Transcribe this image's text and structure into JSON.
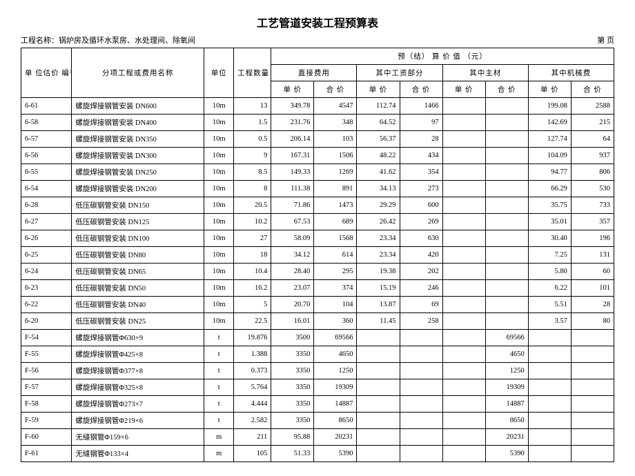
{
  "title": "工艺管道安装工程预算表",
  "project_label": "工程名称：锅炉房及循环水泵房、水处理间、除氧间",
  "page_label": "第  页",
  "headers": {
    "code": "单  位估价\n编号",
    "name": "分项工程或费用名称",
    "unit": "单位",
    "qty": "工程数量",
    "budget_group": "预（结） 算 价 值 （元）",
    "direct": "直接费用",
    "labor": "其中工资部分",
    "material": "其中主材",
    "machine": "其中机械费",
    "unit_price": "单  价",
    "total_price": "合  价"
  },
  "rows": [
    {
      "code": "6-61",
      "name": "螺旋焊接钢管安装 DN600",
      "unit": "10m",
      "qty": "13",
      "du": "349.78",
      "dt": "4547",
      "lu": "112.74",
      "lt": "1466",
      "mu": "",
      "mt": "",
      "ju": "199.08",
      "jt": "2588"
    },
    {
      "code": "6-58",
      "name": "螺旋焊接钢管安装 DN400",
      "unit": "10m",
      "qty": "1.5",
      "du": "231.76",
      "dt": "348",
      "lu": "64.52",
      "lt": "97",
      "mu": "",
      "mt": "",
      "ju": "142.69",
      "jt": "215"
    },
    {
      "code": "6-57",
      "name": "螺旋焊接钢管安装 DN350",
      "unit": "10m",
      "qty": "0.5",
      "du": "206.14",
      "dt": "103",
      "lu": "56.37",
      "lt": "28",
      "mu": "",
      "mt": "",
      "ju": "127.74",
      "jt": "64"
    },
    {
      "code": "6-56",
      "name": "螺旋焊接钢管安装 DN300",
      "unit": "10m",
      "qty": "9",
      "du": "167.31",
      "dt": "1506",
      "lu": "48.22",
      "lt": "434",
      "mu": "",
      "mt": "",
      "ju": "104.09",
      "jt": "937"
    },
    {
      "code": "6-55",
      "name": "螺旋焊接钢管安装 DN250",
      "unit": "10m",
      "qty": "8.5",
      "du": "149.33",
      "dt": "1269",
      "lu": "41.62",
      "lt": "354",
      "mu": "",
      "mt": "",
      "ju": "94.77",
      "jt": "806"
    },
    {
      "code": "6-54",
      "name": "螺旋焊接钢管安装 DN200",
      "unit": "10m",
      "qty": "8",
      "du": "111.38",
      "dt": "891",
      "lu": "34.13",
      "lt": "273",
      "mu": "",
      "mt": "",
      "ju": "66.29",
      "jt": "530"
    },
    {
      "code": "6-28",
      "name": "低压碳钢管安装 DN150",
      "unit": "10m",
      "qty": "20.5",
      "du": "71.86",
      "dt": "1473",
      "lu": "29.29",
      "lt": "600",
      "mu": "",
      "mt": "",
      "ju": "35.75",
      "jt": "733"
    },
    {
      "code": "6-27",
      "name": "低压碳钢管安装 DN125",
      "unit": "10m",
      "qty": "10.2",
      "du": "67.53",
      "dt": "689",
      "lu": "26.42",
      "lt": "269",
      "mu": "",
      "mt": "",
      "ju": "35.01",
      "jt": "357"
    },
    {
      "code": "6-26",
      "name": "低压碳钢管安装 DN100",
      "unit": "10m",
      "qty": "27",
      "du": "58.09",
      "dt": "1568",
      "lu": "23.34",
      "lt": "630",
      "mu": "",
      "mt": "",
      "ju": "30.40",
      "jt": "196"
    },
    {
      "code": "6-25",
      "name": "低压碳钢管安装 DN80",
      "unit": "10m",
      "qty": "18",
      "du": "34.12",
      "dt": "614",
      "lu": "23.34",
      "lt": "420",
      "mu": "",
      "mt": "",
      "ju": "7.25",
      "jt": "131"
    },
    {
      "code": "6-24",
      "name": "低压碳钢管安装 DN65",
      "unit": "10m",
      "qty": "10.4",
      "du": "28.40",
      "dt": "295",
      "lu": "19.38",
      "lt": "202",
      "mu": "",
      "mt": "",
      "ju": "5.80",
      "jt": "60"
    },
    {
      "code": "6-23",
      "name": "低压碳钢管安装 DN50",
      "unit": "10m",
      "qty": "16.2",
      "du": "23.07",
      "dt": "374",
      "lu": "15.19",
      "lt": "246",
      "mu": "",
      "mt": "",
      "ju": "6.22",
      "jt": "101"
    },
    {
      "code": "6-22",
      "name": "低压碳钢管安装 DN40",
      "unit": "10m",
      "qty": "5",
      "du": "20.70",
      "dt": "104",
      "lu": "13.87",
      "lt": "69",
      "mu": "",
      "mt": "",
      "ju": "5.51",
      "jt": "28"
    },
    {
      "code": "6-20",
      "name": "低压碳钢管安装 DN25",
      "unit": "10m",
      "qty": "22.5",
      "du": "16.01",
      "dt": "360",
      "lu": "11.45",
      "lt": "258",
      "mu": "",
      "mt": "",
      "ju": "3.57",
      "jt": "80"
    },
    {
      "code": "F-54",
      "name": "螺旋焊接钢管Φ630×9",
      "unit": "t",
      "qty": "19.876",
      "du": "3500",
      "dt": "69566",
      "lu": "",
      "lt": "",
      "mu": "",
      "mt": "69566",
      "ju": "",
      "jt": ""
    },
    {
      "code": "F-55",
      "name": "螺旋焊接钢管Φ425×8",
      "unit": "t",
      "qty": "1.388",
      "du": "3350",
      "dt": "4650",
      "lu": "",
      "lt": "",
      "mu": "",
      "mt": "4650",
      "ju": "",
      "jt": ""
    },
    {
      "code": "F-56",
      "name": "螺旋焊接钢管Φ377×8",
      "unit": "t",
      "qty": "0.373",
      "du": "3350",
      "dt": "1250",
      "lu": "",
      "lt": "",
      "mu": "",
      "mt": "1250",
      "ju": "",
      "jt": ""
    },
    {
      "code": "F-57",
      "name": "螺旋焊接钢管Φ325×8",
      "unit": "t",
      "qty": "5.764",
      "du": "3350",
      "dt": "19309",
      "lu": "",
      "lt": "",
      "mu": "",
      "mt": "19309",
      "ju": "",
      "jt": ""
    },
    {
      "code": "F-58",
      "name": "螺旋焊接钢管Φ273×7",
      "unit": "t",
      "qty": "4.444",
      "du": "3350",
      "dt": "14887",
      "lu": "",
      "lt": "",
      "mu": "",
      "mt": "14887",
      "ju": "",
      "jt": ""
    },
    {
      "code": "F-59",
      "name": "螺旋焊接钢管Φ219×6",
      "unit": "t",
      "qty": "2.582",
      "du": "3350",
      "dt": "8650",
      "lu": "",
      "lt": "",
      "mu": "",
      "mt": "8650",
      "ju": "",
      "jt": ""
    },
    {
      "code": "F-60",
      "name": "无缝钢管Φ159×6",
      "unit": "m",
      "qty": "211",
      "du": "95.88",
      "dt": "20231",
      "lu": "",
      "lt": "",
      "mu": "",
      "mt": "20231",
      "ju": "",
      "jt": ""
    },
    {
      "code": "F-61",
      "name": "无缝钢管Φ133×4",
      "unit": "m",
      "qty": "105",
      "du": "51.33",
      "dt": "5390",
      "lu": "",
      "lt": "",
      "mu": "",
      "mt": "5390",
      "ju": "",
      "jt": ""
    }
  ]
}
